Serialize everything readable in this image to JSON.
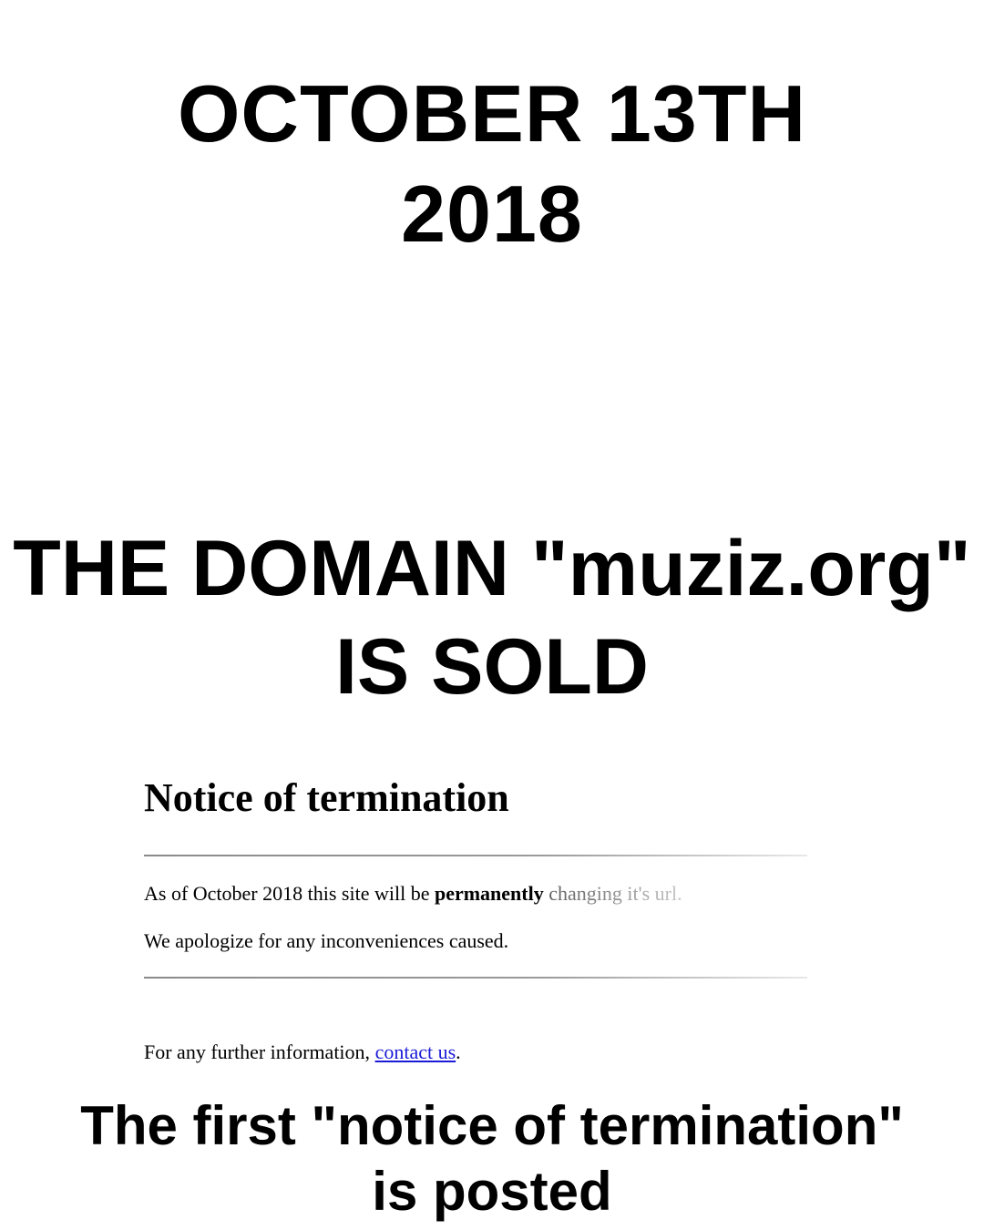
{
  "date": {
    "line1": "OCTOBER 13TH",
    "line2": "2018"
  },
  "domain": {
    "line1": "THE DOMAIN \"muziz.org\"",
    "line2": "IS SOLD"
  },
  "notice": {
    "title": "Notice of termination",
    "line1_prefix": "As of October 2018 this site will be ",
    "line1_bold": "permanently",
    "line1_suffix": " changing it's url.",
    "line2": "We apologize for any inconveniences caused.",
    "line3_prefix": "For any further information, ",
    "link_text": "contact us",
    "line3_suffix": "."
  },
  "caption": {
    "line1": "The first \"notice of termination\"",
    "line2": "is posted"
  },
  "colors": {
    "background": "#ffffff",
    "text": "#000000",
    "link": "#1a1ad8",
    "rule": "#9a9a9a"
  }
}
